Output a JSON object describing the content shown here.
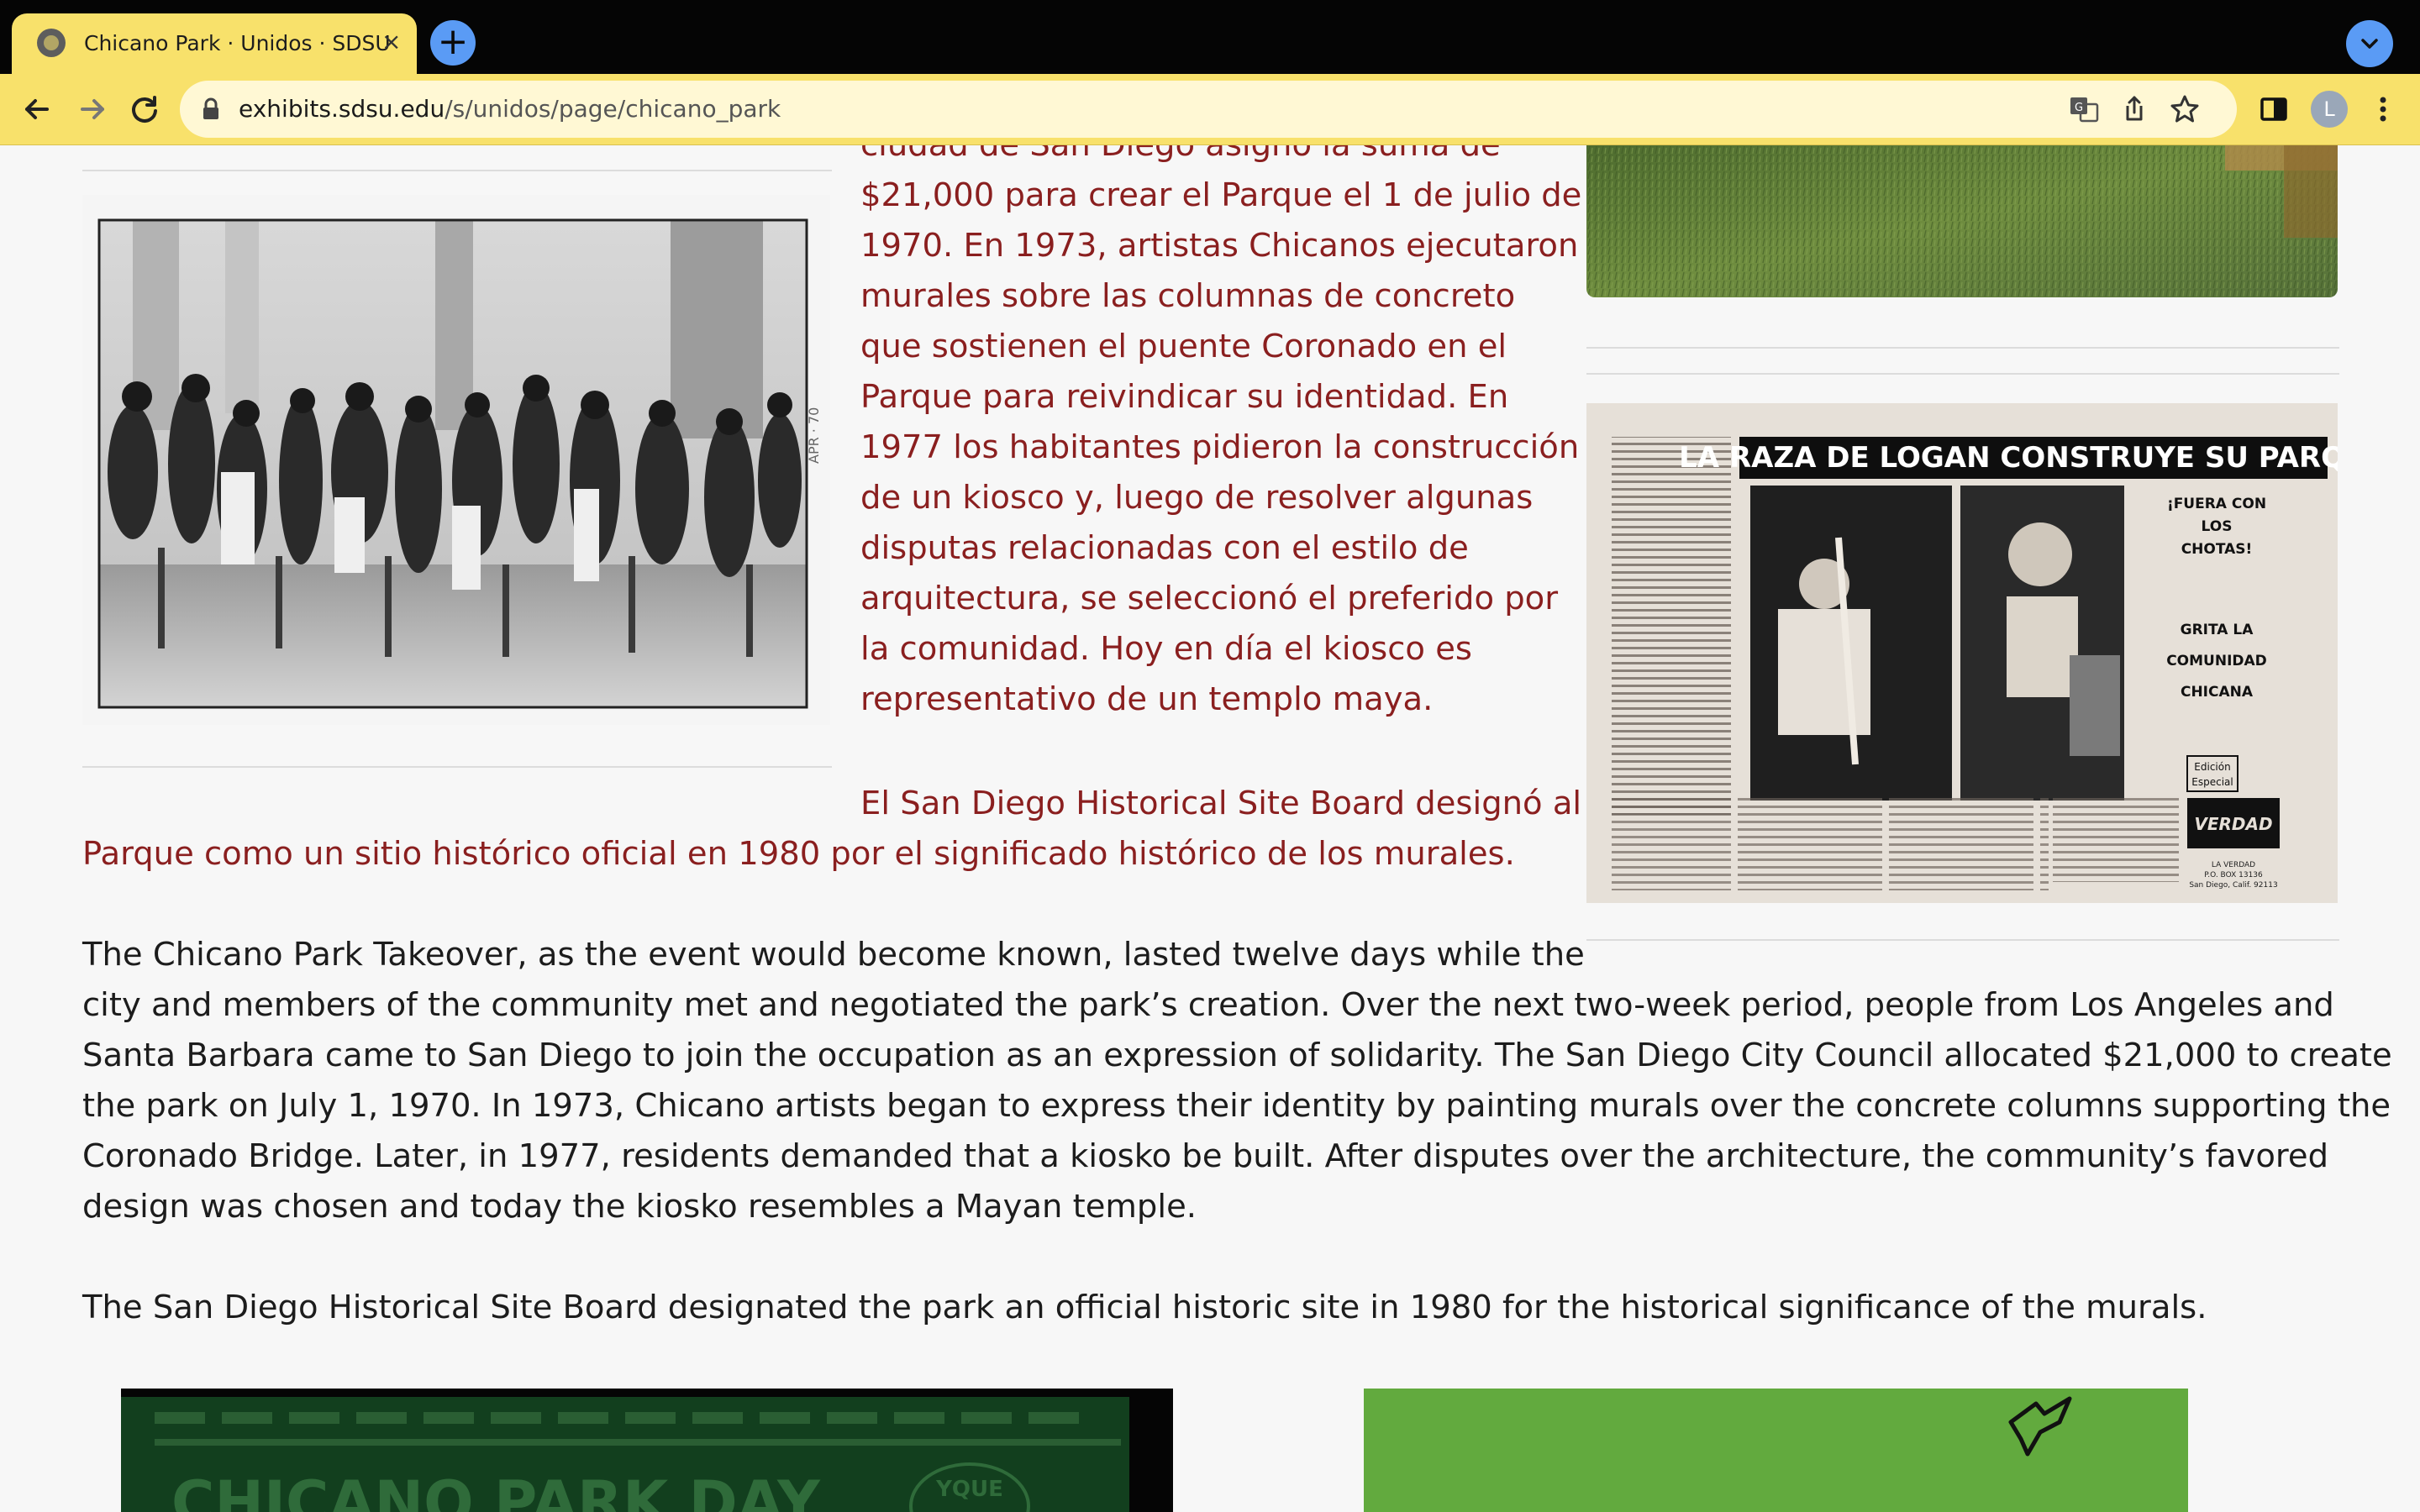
{
  "browser": {
    "tab_title": "Chicano Park · Unidos · SDSU",
    "tab_close": "×",
    "new_tab": "+",
    "tab_menu": "⌄",
    "url_host": "exhibits.sdsu.edu",
    "url_path": "/s/unidos/page/chicano_park",
    "profile_initial": "L",
    "icons": {
      "back": "←",
      "forward": "→",
      "reload": "↻",
      "translate": "文",
      "share": "⇧",
      "bookmark": "☆",
      "sidepanel": "▮",
      "menu": "⋮"
    },
    "colors": {
      "tab_strip": "#050505",
      "toolbar": "#f8e16b",
      "accent_blue": "#5a9bf5"
    }
  },
  "page": {
    "spanish_paragraph_lines": [
      "ciudad de San Diego asignó la suma de",
      "$21,000 para crear el Parque el 1 de julio de",
      "1970. En 1973, artistas Chicanos ejecutaron",
      "murales sobre las columnas de concreto",
      "que sostienen el puente Coronado en el",
      "Parque para reivindicar su identidad. En",
      "1977 los habitantes pidieron la construcción",
      "de un kiosco y, luego de resolver algunas",
      "disputas relacionadas con el estilo de",
      "arquitectura, se seleccionó el preferido por",
      "la comunidad. Hoy en día el kiosco es",
      "representativo de un templo maya."
    ],
    "spanish_site_board_lines": [
      "El San Diego Historical Site Board designó al",
      "Parque como un sitio histórico oficial en 1980 por el significado histórico de los murales."
    ],
    "english_paragraph_lines": [
      "The Chicano Park Takeover, as the event would become known, lasted twelve days while the",
      "city and members of the community met and negotiated the park’s creation.  Over the next two-week period, people from Los Angeles and",
      "Santa Barbara came to San Diego to join the occupation as an expression of solidarity.  The San Diego City Council allocated $21,000 to create",
      "the park on July 1, 1970. In 1973, Chicano artists began to express their identity by painting murals over the concrete columns supporting the",
      "Coronado Bridge. Later, in 1977, residents demanded that a kiosko be built. After disputes over the architecture, the community’s favored",
      "design was chosen and today the kiosko resembles a Mayan temple."
    ],
    "english_site_board": "The San Diego Historical Site Board designated the park an official historic site in 1980 for the historical significance of the murals.",
    "newspaper": {
      "headline": "LA RAZA DE LOGAN CONSTRUYE SU PARQUE",
      "slogan_1": "¡FUERA CON LOS CHOTAS!",
      "slogan_2": "GRITA LA COMUNIDAD CHICANA",
      "badge": "Edición Especial",
      "masthead": "La Verdad",
      "footer": "LA VERDAD P.O. BOX 13136 San Diego, Calif. 92113"
    },
    "photo_stamp": "APR · 70",
    "flyer_text": "CHICANO PARK DAY",
    "flyer_seal": "YQUE"
  }
}
